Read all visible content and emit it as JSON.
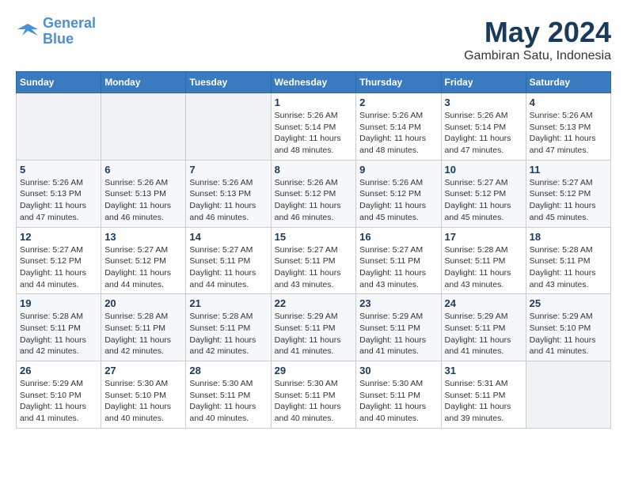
{
  "logo": {
    "line1": "General",
    "line2": "Blue"
  },
  "title": "May 2024",
  "location": "Gambiran Satu, Indonesia",
  "weekdays": [
    "Sunday",
    "Monday",
    "Tuesday",
    "Wednesday",
    "Thursday",
    "Friday",
    "Saturday"
  ],
  "weeks": [
    [
      {
        "day": "",
        "detail": ""
      },
      {
        "day": "",
        "detail": ""
      },
      {
        "day": "",
        "detail": ""
      },
      {
        "day": "1",
        "detail": "Sunrise: 5:26 AM\nSunset: 5:14 PM\nDaylight: 11 hours\nand 48 minutes."
      },
      {
        "day": "2",
        "detail": "Sunrise: 5:26 AM\nSunset: 5:14 PM\nDaylight: 11 hours\nand 48 minutes."
      },
      {
        "day": "3",
        "detail": "Sunrise: 5:26 AM\nSunset: 5:14 PM\nDaylight: 11 hours\nand 47 minutes."
      },
      {
        "day": "4",
        "detail": "Sunrise: 5:26 AM\nSunset: 5:13 PM\nDaylight: 11 hours\nand 47 minutes."
      }
    ],
    [
      {
        "day": "5",
        "detail": "Sunrise: 5:26 AM\nSunset: 5:13 PM\nDaylight: 11 hours\nand 47 minutes."
      },
      {
        "day": "6",
        "detail": "Sunrise: 5:26 AM\nSunset: 5:13 PM\nDaylight: 11 hours\nand 46 minutes."
      },
      {
        "day": "7",
        "detail": "Sunrise: 5:26 AM\nSunset: 5:13 PM\nDaylight: 11 hours\nand 46 minutes."
      },
      {
        "day": "8",
        "detail": "Sunrise: 5:26 AM\nSunset: 5:12 PM\nDaylight: 11 hours\nand 46 minutes."
      },
      {
        "day": "9",
        "detail": "Sunrise: 5:26 AM\nSunset: 5:12 PM\nDaylight: 11 hours\nand 45 minutes."
      },
      {
        "day": "10",
        "detail": "Sunrise: 5:27 AM\nSunset: 5:12 PM\nDaylight: 11 hours\nand 45 minutes."
      },
      {
        "day": "11",
        "detail": "Sunrise: 5:27 AM\nSunset: 5:12 PM\nDaylight: 11 hours\nand 45 minutes."
      }
    ],
    [
      {
        "day": "12",
        "detail": "Sunrise: 5:27 AM\nSunset: 5:12 PM\nDaylight: 11 hours\nand 44 minutes."
      },
      {
        "day": "13",
        "detail": "Sunrise: 5:27 AM\nSunset: 5:12 PM\nDaylight: 11 hours\nand 44 minutes."
      },
      {
        "day": "14",
        "detail": "Sunrise: 5:27 AM\nSunset: 5:11 PM\nDaylight: 11 hours\nand 44 minutes."
      },
      {
        "day": "15",
        "detail": "Sunrise: 5:27 AM\nSunset: 5:11 PM\nDaylight: 11 hours\nand 43 minutes."
      },
      {
        "day": "16",
        "detail": "Sunrise: 5:27 AM\nSunset: 5:11 PM\nDaylight: 11 hours\nand 43 minutes."
      },
      {
        "day": "17",
        "detail": "Sunrise: 5:28 AM\nSunset: 5:11 PM\nDaylight: 11 hours\nand 43 minutes."
      },
      {
        "day": "18",
        "detail": "Sunrise: 5:28 AM\nSunset: 5:11 PM\nDaylight: 11 hours\nand 43 minutes."
      }
    ],
    [
      {
        "day": "19",
        "detail": "Sunrise: 5:28 AM\nSunset: 5:11 PM\nDaylight: 11 hours\nand 42 minutes."
      },
      {
        "day": "20",
        "detail": "Sunrise: 5:28 AM\nSunset: 5:11 PM\nDaylight: 11 hours\nand 42 minutes."
      },
      {
        "day": "21",
        "detail": "Sunrise: 5:28 AM\nSunset: 5:11 PM\nDaylight: 11 hours\nand 42 minutes."
      },
      {
        "day": "22",
        "detail": "Sunrise: 5:29 AM\nSunset: 5:11 PM\nDaylight: 11 hours\nand 41 minutes."
      },
      {
        "day": "23",
        "detail": "Sunrise: 5:29 AM\nSunset: 5:11 PM\nDaylight: 11 hours\nand 41 minutes."
      },
      {
        "day": "24",
        "detail": "Sunrise: 5:29 AM\nSunset: 5:11 PM\nDaylight: 11 hours\nand 41 minutes."
      },
      {
        "day": "25",
        "detail": "Sunrise: 5:29 AM\nSunset: 5:10 PM\nDaylight: 11 hours\nand 41 minutes."
      }
    ],
    [
      {
        "day": "26",
        "detail": "Sunrise: 5:29 AM\nSunset: 5:10 PM\nDaylight: 11 hours\nand 41 minutes."
      },
      {
        "day": "27",
        "detail": "Sunrise: 5:30 AM\nSunset: 5:10 PM\nDaylight: 11 hours\nand 40 minutes."
      },
      {
        "day": "28",
        "detail": "Sunrise: 5:30 AM\nSunset: 5:11 PM\nDaylight: 11 hours\nand 40 minutes."
      },
      {
        "day": "29",
        "detail": "Sunrise: 5:30 AM\nSunset: 5:11 PM\nDaylight: 11 hours\nand 40 minutes."
      },
      {
        "day": "30",
        "detail": "Sunrise: 5:30 AM\nSunset: 5:11 PM\nDaylight: 11 hours\nand 40 minutes."
      },
      {
        "day": "31",
        "detail": "Sunrise: 5:31 AM\nSunset: 5:11 PM\nDaylight: 11 hours\nand 39 minutes."
      },
      {
        "day": "",
        "detail": ""
      }
    ]
  ]
}
